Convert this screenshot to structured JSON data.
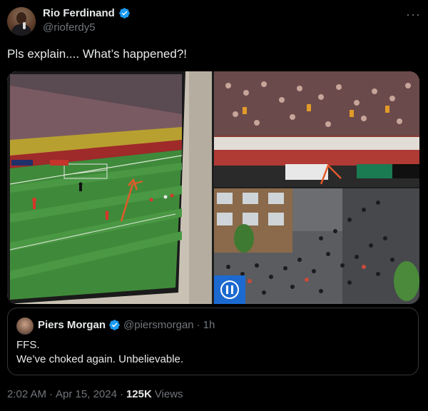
{
  "author": {
    "display_name": "Rio Ferdinand",
    "handle": "@rioferdy5",
    "verified": true,
    "more_icon": "more-horizontal-icon"
  },
  "tweet": {
    "text": "Pls explain.... What’s happened?!"
  },
  "media": {
    "images": [
      {
        "name": "tv-football-match-photo"
      },
      {
        "name": "stadium-stand-photo"
      },
      {
        "name": "street-crowd-photo"
      }
    ]
  },
  "quote": {
    "display_name": "Piers Morgan",
    "handle": "@piersmorgan",
    "separator": "·",
    "time": "1h",
    "line1": "FFS.",
    "line2": "We’ve choked again. Unbelievable."
  },
  "meta": {
    "time": "2:02 AM",
    "separator1": "·",
    "date": "Apr 15, 2024",
    "separator2": "·",
    "views_count": "125K",
    "views_label": "Views"
  },
  "colors": {
    "background": "#000000",
    "text_primary": "#e7e9ea",
    "text_secondary": "#71767b",
    "verified_blue": "#1d9bf0",
    "border": "#333639"
  }
}
